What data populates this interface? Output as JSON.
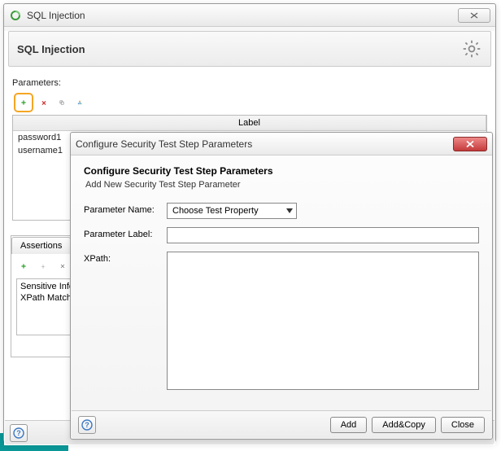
{
  "main": {
    "window_title": "SQL Injection",
    "header_title": "SQL Injection",
    "parameters_label": "Parameters:",
    "label_header": "Label",
    "params": [
      "password1",
      "username1"
    ],
    "assertions_tab": "Assertions",
    "assertions": [
      "Sensitive Information Exposure",
      "XPath Match"
    ]
  },
  "dialog": {
    "title": "Configure Security Test Step Parameters",
    "heading": "Configure Security Test Step Parameters",
    "subheading": "Add New Security Test Step Parameter",
    "pname_label": "Parameter Name:",
    "pname_selected": "Choose Test Property",
    "plabel_label": "Parameter Label:",
    "plabel_value": "",
    "xpath_label": "XPath:",
    "xpath_value": "",
    "btn_add": "Add",
    "btn_addcopy": "Add&Copy",
    "btn_close": "Close"
  }
}
